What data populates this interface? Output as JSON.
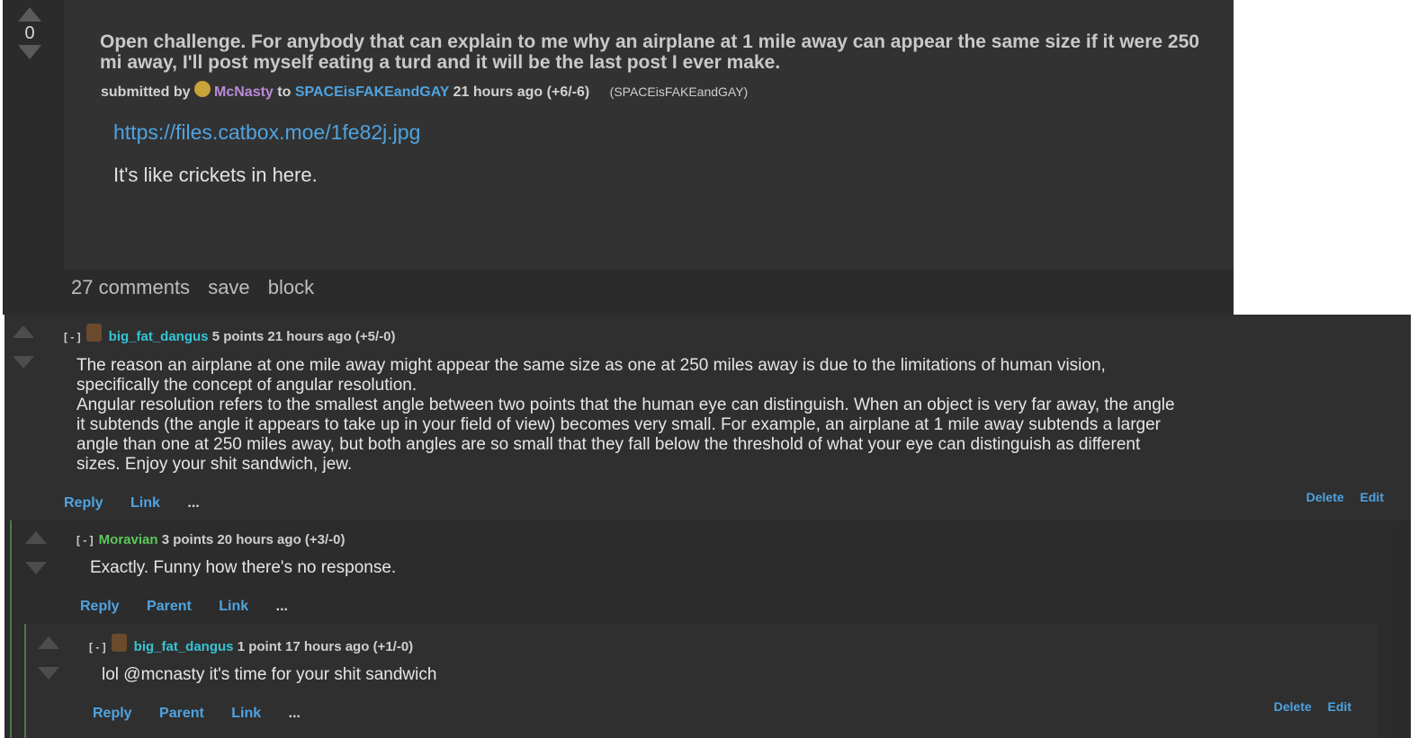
{
  "post": {
    "score": "0",
    "title": "Open challenge. For anybody that can explain to me why an airplane at 1 mile away can appear the same size if it were 250 mi away, I'll post myself eating a turd and it will be the last post I ever make.",
    "submitted_by_label": "submitted by",
    "author": "McNasty",
    "to_label": "to",
    "community": "SPACEisFAKEandGAY",
    "time": "21 hours ago",
    "votes_detail": "(+6/-6)",
    "community_note": "(SPACEisFAKEandGAY)",
    "link_url": "https://files.catbox.moe/1fe82j.jpg",
    "body_text": "It's like crickets in here.",
    "actions": {
      "comments": "27 comments",
      "save": "save",
      "block": "block"
    }
  },
  "comments": [
    {
      "toggle": "[ - ]",
      "author": "big_fat_dangus",
      "points": "5 points",
      "time": "21 hours ago",
      "votes_detail": "(+5/-0)",
      "text_lines": [
        "The reason an airplane at one mile away might appear the same size as one at 250 miles away is due to the limitations of human vision,",
        "specifically the concept of angular resolution.",
        "Angular resolution refers to the smallest angle between two points that the human eye can distinguish. When an object is very far away, the angle",
        "it subtends (the angle it appears to take up in your field of view) becomes very small. For example, an airplane at 1 mile away subtends a larger",
        "angle than one at 250 miles away, but both angles are so small that they fall below the threshold of what your eye can distinguish as different",
        "sizes. Enjoy your shit sandwich, jew."
      ],
      "actions": {
        "reply": "Reply",
        "link": "Link",
        "more": "..."
      },
      "right_actions": {
        "delete": "Delete",
        "edit": "Edit"
      }
    },
    {
      "toggle": "[ - ]",
      "author": "Moravian",
      "points": "3 points",
      "time": "20 hours ago",
      "votes_detail": "(+3/-0)",
      "text": "Exactly. Funny how there's no response.",
      "actions": {
        "reply": "Reply",
        "parent": "Parent",
        "link": "Link",
        "more": "..."
      }
    },
    {
      "toggle": "[ - ]",
      "author": "big_fat_dangus",
      "points": "1 point",
      "time": "17 hours ago",
      "votes_detail": "(+1/-0)",
      "text": "lol @mcnasty it's time for your shit sandwich",
      "actions": {
        "reply": "Reply",
        "parent": "Parent",
        "link": "Link",
        "more": "..."
      },
      "right_actions": {
        "delete": "Delete",
        "edit": "Edit"
      }
    }
  ]
}
